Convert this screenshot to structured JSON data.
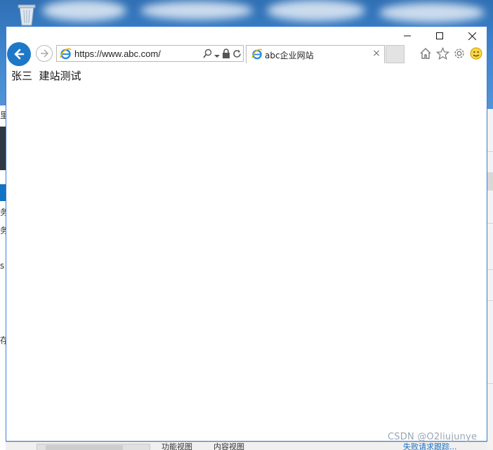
{
  "desktop": {
    "recycle_bin_icon": "recycle-bin-icon",
    "watermark": "CSDN @O2liujunye",
    "background_window": {
      "left_glyphs": [
        "里",
        "务",
        "务",
        "s",
        "存"
      ],
      "bottom_tabs": [
        "功能视图",
        "内容视图"
      ],
      "bottom_right_link": "失败请求跟踪..."
    }
  },
  "browser": {
    "window_controls": {
      "minimize": "—",
      "maximize": "☐",
      "close": "✕"
    },
    "nav": {
      "back_icon": "arrow-left-icon",
      "forward_icon": "arrow-right-icon"
    },
    "address": {
      "url": "https://www.abc.com/",
      "site_icon": "ie-logo-icon",
      "tools": [
        "search-icon",
        "dropdown-arrow-icon",
        "lock-icon",
        "refresh-icon"
      ]
    },
    "tab": {
      "title": "abc企业网站",
      "close": "×"
    },
    "toolbar_icons": [
      "home-icon",
      "favorites-star-icon",
      "settings-gear-icon",
      "feedback-smiley-icon"
    ],
    "page": {
      "text": "张三  建站测试"
    },
    "colors": {
      "accent": "#1e78c8",
      "border": "#3a7bd5"
    }
  }
}
